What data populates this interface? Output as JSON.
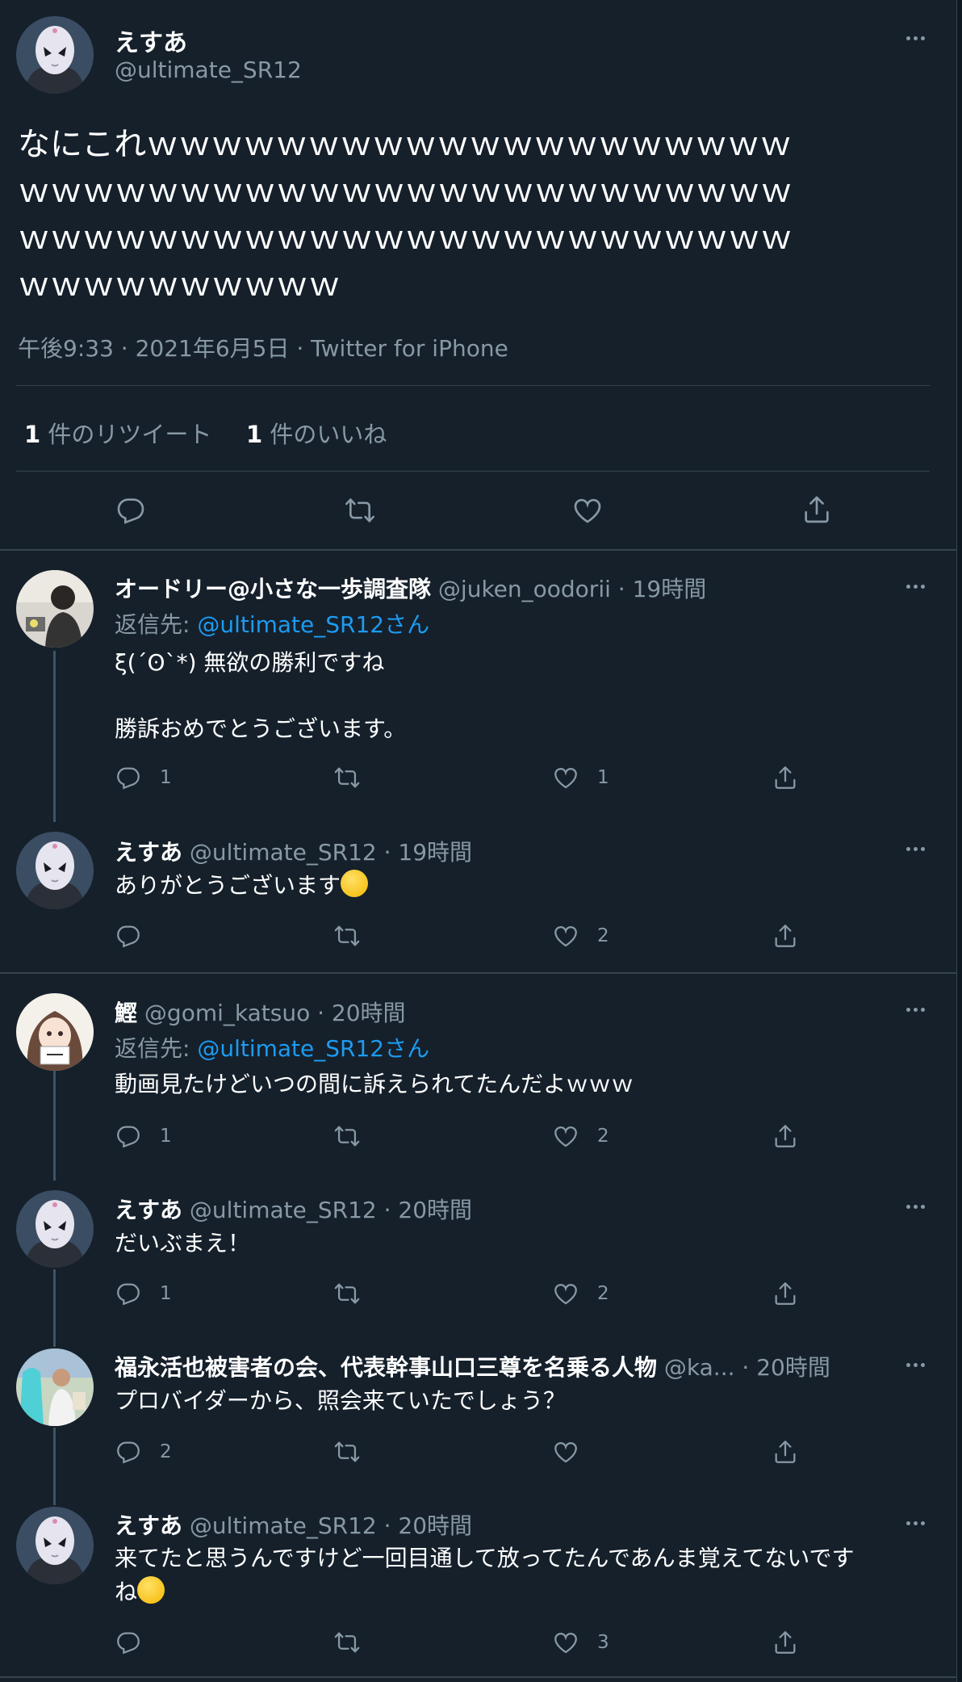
{
  "main_tweet": {
    "display_name": "えすあ",
    "handle": "@ultimate_SR12",
    "text_lines": [
      "なにこれｗｗｗｗｗｗｗｗｗｗｗｗｗｗｗｗｗｗｗｗ",
      "ｗｗｗｗｗｗｗｗｗｗｗｗｗｗｗｗｗｗｗｗｗｗｗｗ",
      "ｗｗｗｗｗｗｗｗｗｗｗｗｗｗｗｗｗｗｗｗｗｗｗｗ",
      "ｗｗｗｗｗｗｗｗｗｗ"
    ],
    "meta": "午後9:33 · 2021年6月5日 · Twitter for iPhone",
    "retweet_count": "1",
    "retweet_label": " 件のリツイート",
    "like_count": "1",
    "like_label": " 件のいいね"
  },
  "replies": [
    {
      "display_name": "オードリー@小さな一歩調査隊",
      "handle": "@juken_oodorii",
      "time": " · 19時間",
      "reply_prefix": "返信先: ",
      "reply_to": "@ultimate_SR12",
      "reply_suffix": "さん",
      "lines": [
        "ξ(´ʘ`*) 無欲の勝利ですね",
        "",
        "勝訴おめでとうございます。"
      ],
      "reply_count": "1",
      "like_count": "1"
    },
    {
      "display_name": "えすあ",
      "handle": "@ultimate_SR12",
      "time": " · 19時間",
      "lines": [
        "ありがとうございます"
      ],
      "emoji": "smiling-face",
      "reply_count": "",
      "like_count": "2"
    },
    {
      "display_name": "鰹",
      "handle": "@gomi_katsuo",
      "time": " · 20時間",
      "reply_prefix": "返信先: ",
      "reply_to": "@ultimate_SR12",
      "reply_suffix": "さん",
      "lines": [
        "動画見たけどいつの間に訴えられてたんだよｗｗｗ"
      ],
      "reply_count": "1",
      "like_count": "2"
    },
    {
      "display_name": "えすあ",
      "handle": "@ultimate_SR12",
      "time": " · 20時間",
      "lines": [
        "だいぶまえ！"
      ],
      "reply_count": "1",
      "like_count": "2"
    },
    {
      "display_name": "福永活也被害者の会、代表幹事山口三尊を名乗る人物",
      "handle": "@ka...",
      "time": " · 20時間",
      "lines": [
        "プロバイダーから、照会来ていたでしょう？"
      ],
      "reply_count": "2",
      "like_count": ""
    },
    {
      "display_name": "えすあ",
      "handle": "@ultimate_SR12",
      "time": " · 20時間",
      "lines": [
        "来てたと思うんですけど一回目通して放ってたんであんま覚えてないです",
        "ね"
      ],
      "emoji": "downcast-sweat-face",
      "reply_count": "",
      "like_count": "3"
    }
  ],
  "colors": {
    "background": "#15202b",
    "text": "#ffffff",
    "muted": "#8899a6",
    "link": "#1d9bf0",
    "divider": "#38444d"
  }
}
